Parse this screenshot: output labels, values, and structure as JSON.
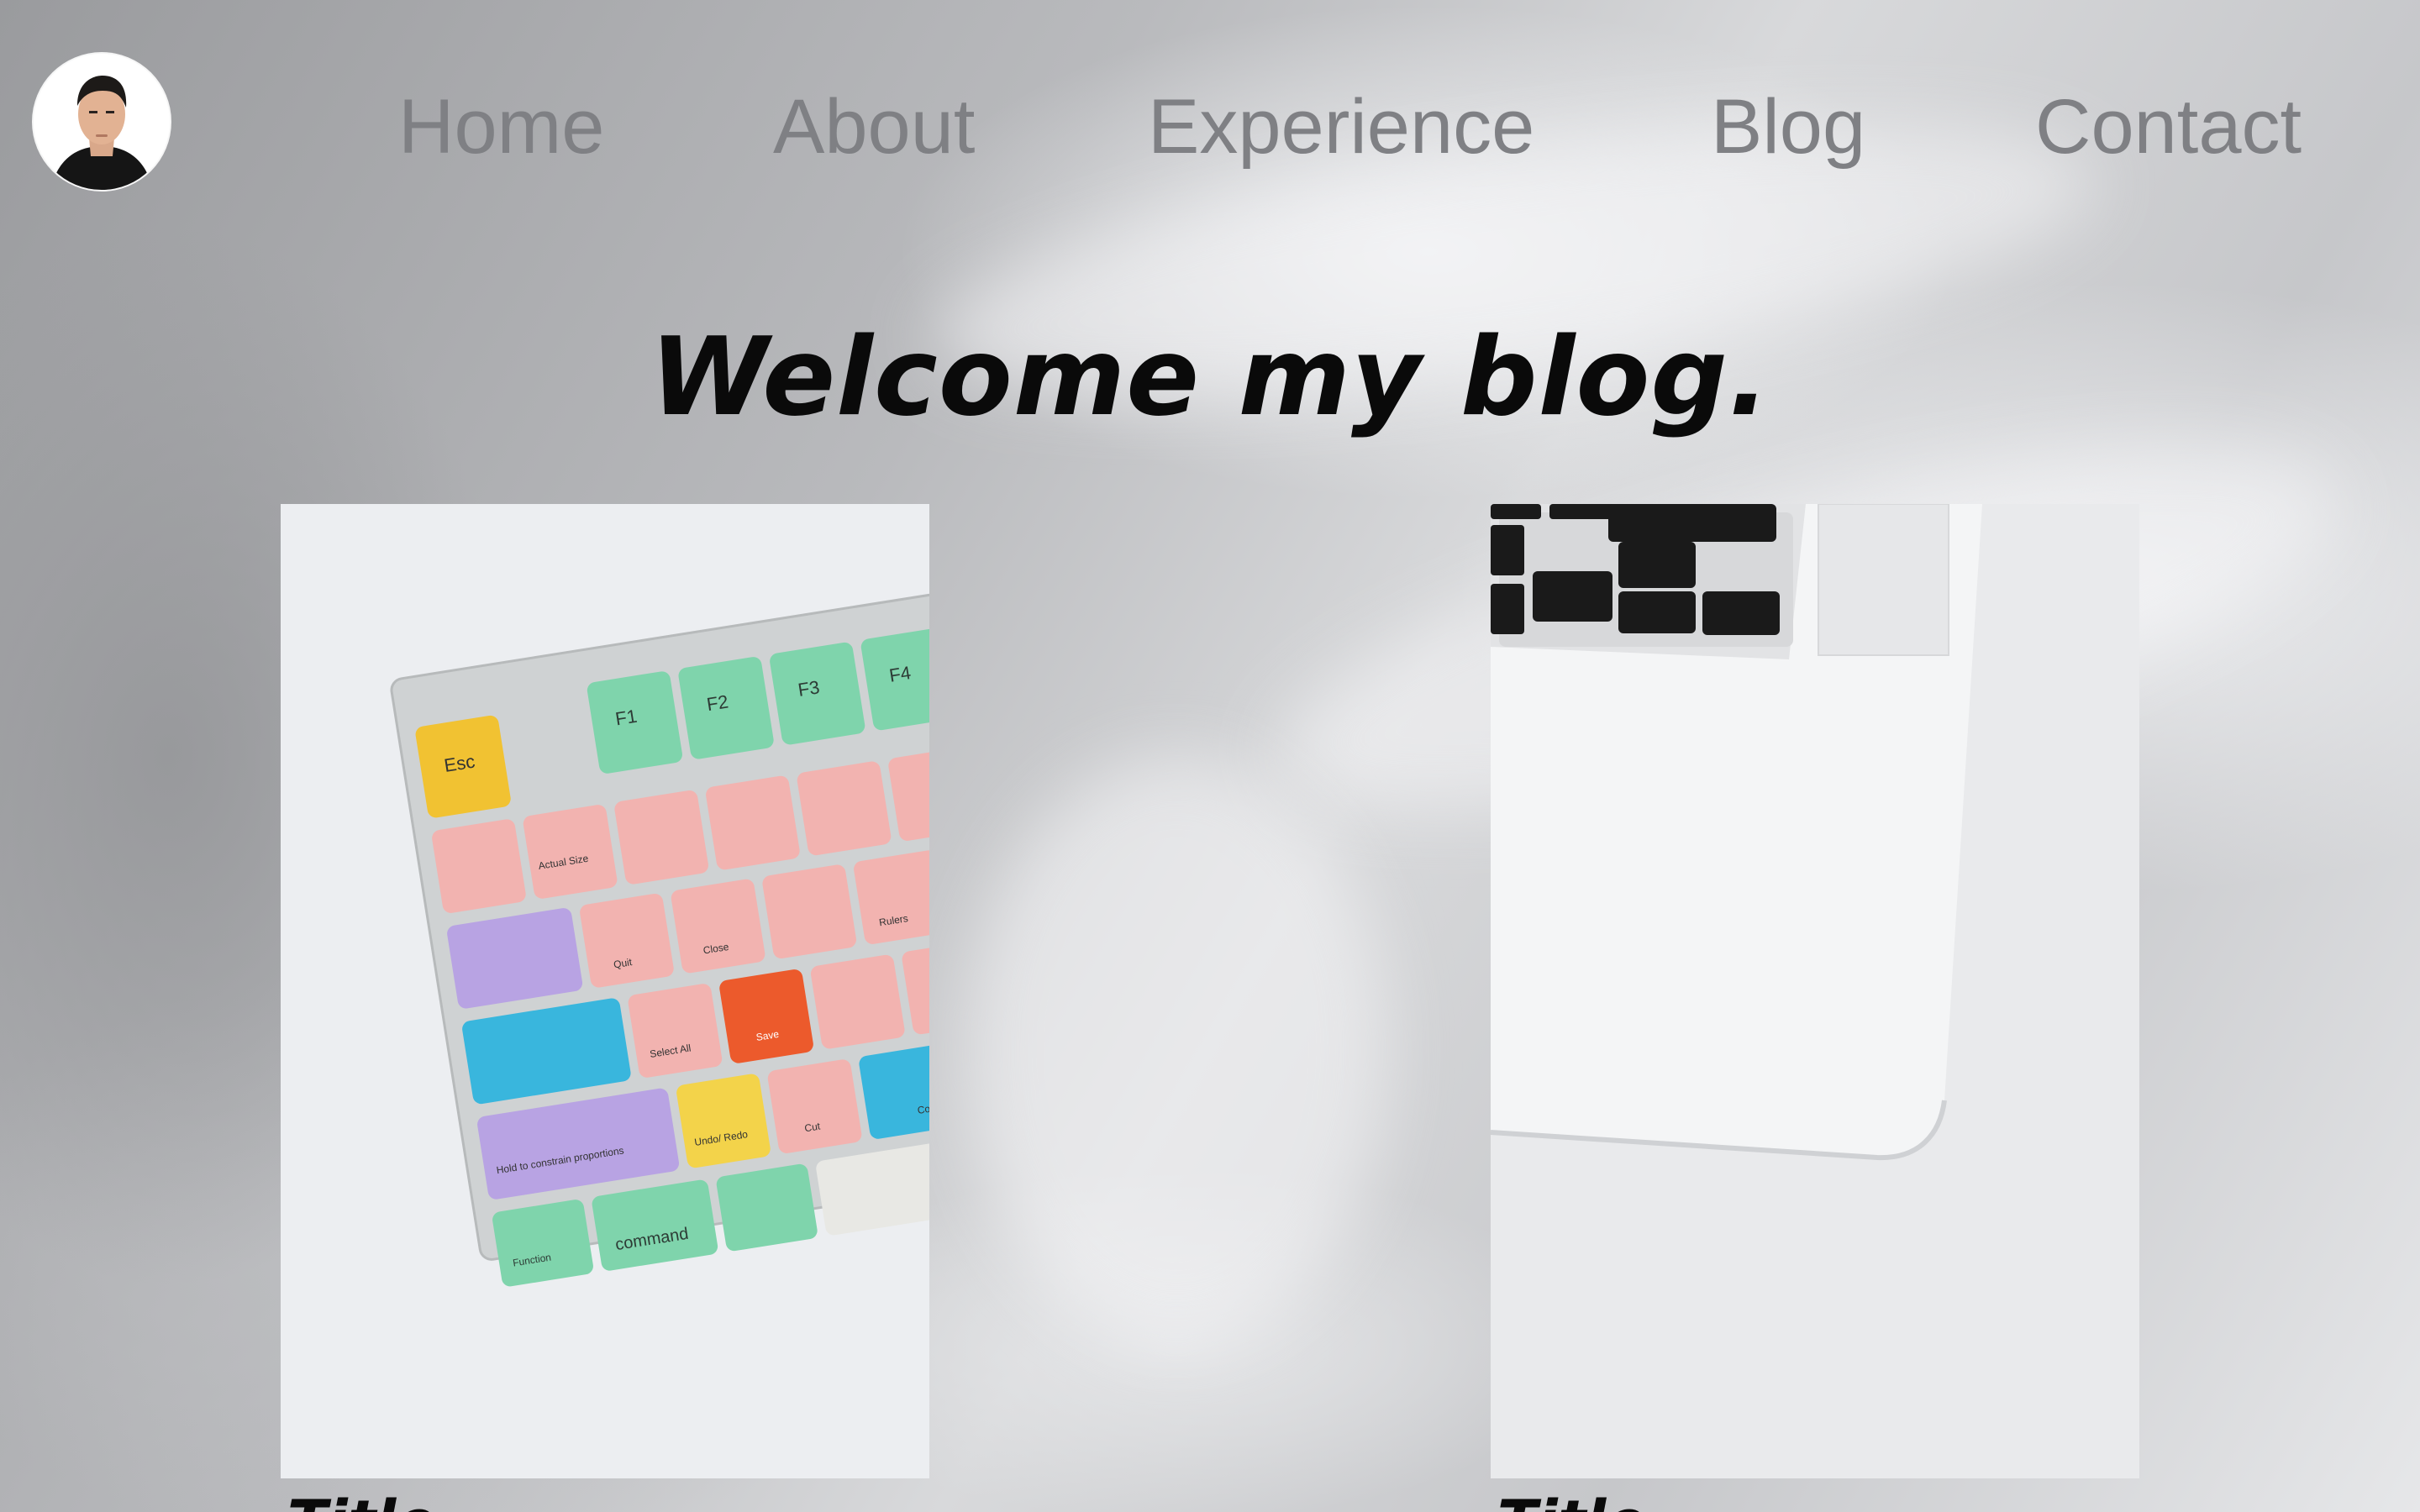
{
  "nav": {
    "avatar_alt": "profile photo",
    "links": [
      {
        "label": "Home"
      },
      {
        "label": "About"
      },
      {
        "label": "Experience"
      },
      {
        "label": "Blog"
      },
      {
        "label": "Contact"
      }
    ]
  },
  "hero": {
    "title": "Welcome my blog."
  },
  "cards": [
    {
      "title": "Title",
      "image": "keyboard-keycaps-image",
      "keycaps": {
        "esc": "Esc",
        "f1": "F1",
        "f2": "F2",
        "f3": "F3",
        "f4": "F4",
        "hold": "Hold to constrain proportions",
        "command": "command",
        "function": "Function",
        "actual_size": "Actual Size",
        "close": "Close",
        "quit": "Quit",
        "rulers": "Rulers",
        "save": "Save",
        "select_all": "Select All",
        "undo_redo": "Undo/ Redo",
        "cut": "Cut",
        "copy": "Cop"
      }
    },
    {
      "title": "Title",
      "image": "laptop-corner-image"
    }
  ]
}
